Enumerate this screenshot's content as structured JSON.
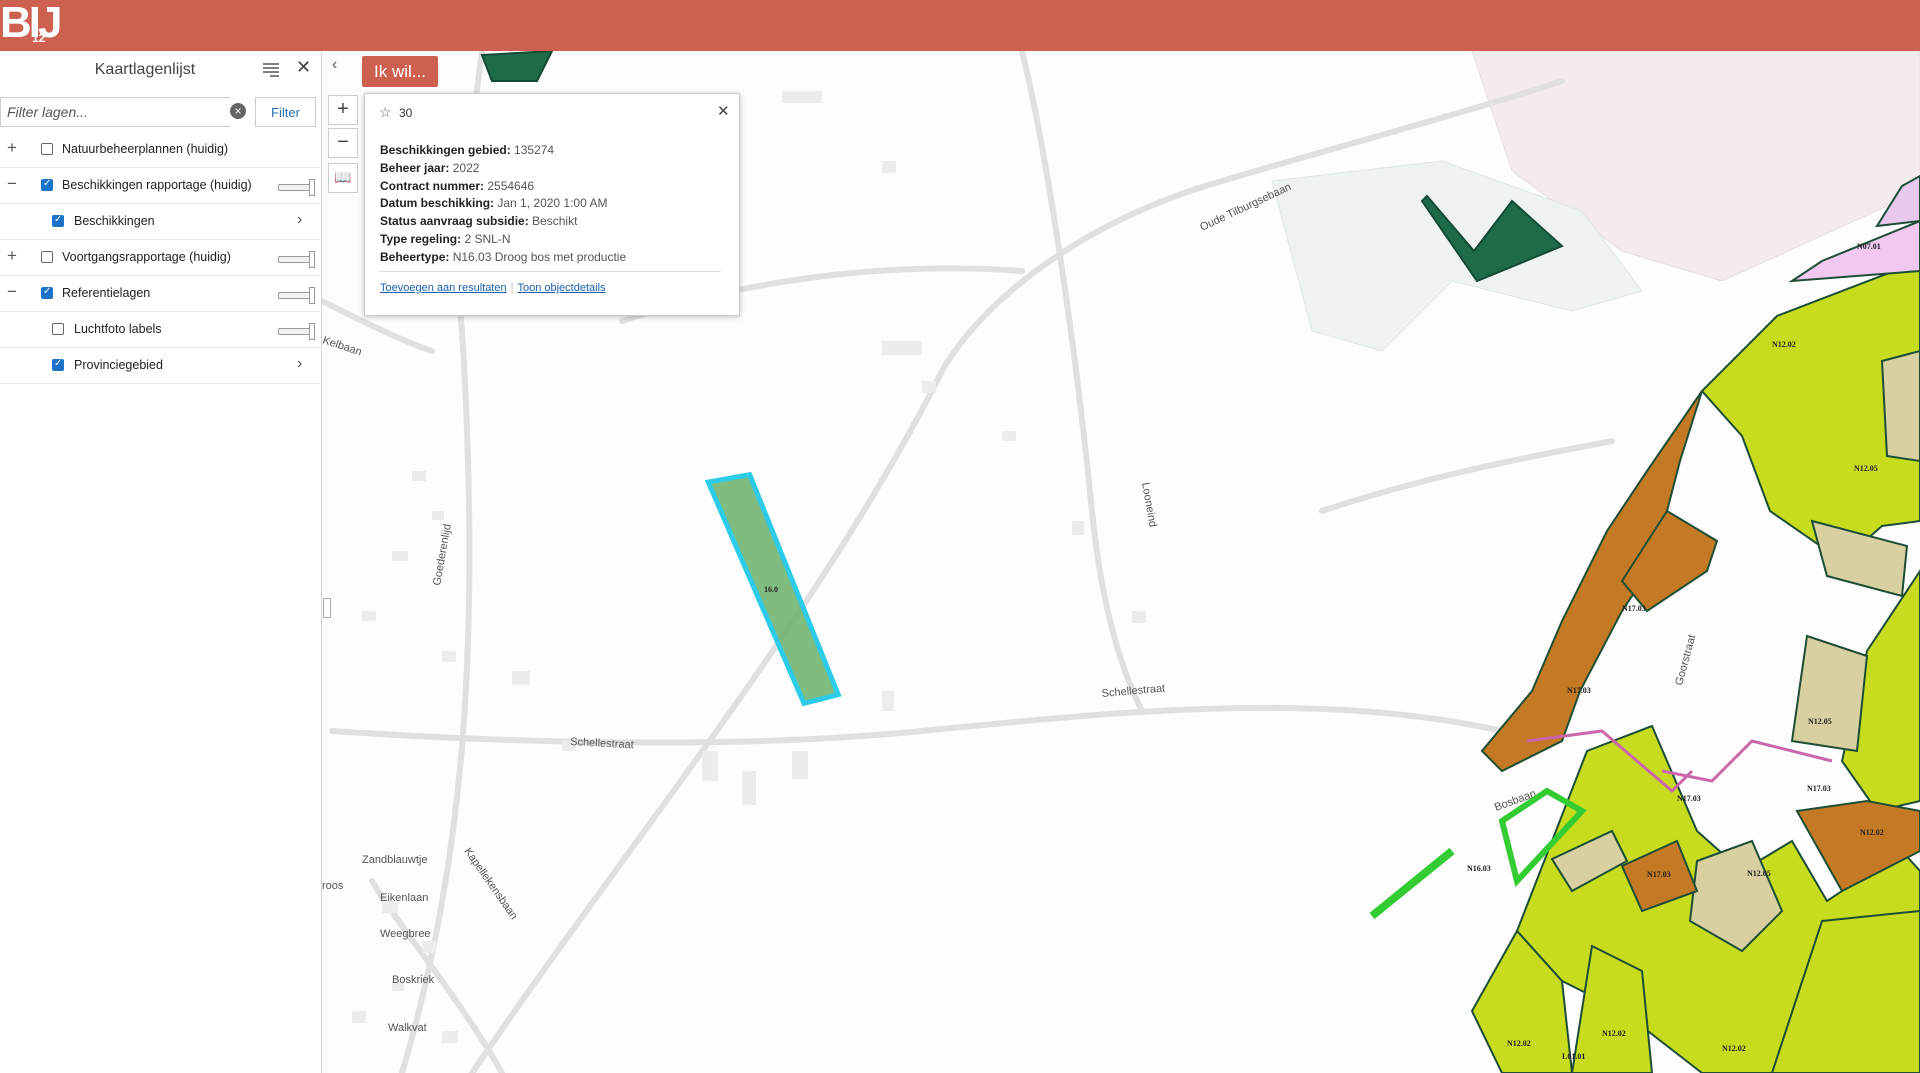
{
  "app": {
    "logo_text": "BIJ",
    "logo_sub": "12",
    "brand_color": "#cd604e"
  },
  "panel": {
    "title": "Kaartlagenlijst",
    "filter_placeholder": "Filter lagen...",
    "filter_button": "Filter",
    "layers": [
      {
        "label": "Natuurbeheerplannen (huidig)",
        "checked": false,
        "expander": "+"
      },
      {
        "label": "Beschikkingen rapportage (huidig)",
        "checked": true,
        "expander": "−"
      },
      {
        "label": "Beschikkingen",
        "checked": true,
        "child": true
      },
      {
        "label": "Voortgangsrapportage (huidig)",
        "checked": false,
        "expander": "+"
      },
      {
        "label": "Referentielagen",
        "checked": true,
        "expander": "−"
      },
      {
        "label": "Luchtfoto labels",
        "checked": false,
        "child": true
      },
      {
        "label": "Provinciegebied",
        "checked": true,
        "child": true
      }
    ]
  },
  "map": {
    "ik_wil_button": "Ik wil...",
    "zoom_in": "+",
    "zoom_out": "−",
    "road_labels": [
      "Kelbaan",
      "Goederenlijd",
      "Oude Tilburgsebaan",
      "Looneind",
      "Schellestraat",
      "Schellestraat",
      "Zandblauwtje",
      "Eikenlaan",
      "Weegbree",
      "Boskriek",
      "Walkvat",
      "Kapellekensbaan",
      "Goorstraat",
      "Bosbaan",
      "roos"
    ],
    "parcel_labels": [
      "N12.02",
      "N12.02",
      "N12.02",
      "N12.05",
      "N12.05",
      "N12.05",
      "N17.03",
      "N17.03",
      "N17.03",
      "N17.03",
      "N17.03",
      "N16.03",
      "N07.01",
      "L01.01",
      "N12.02",
      "N12.02"
    ],
    "selected_label": "16.0"
  },
  "popup": {
    "count": "30",
    "fields": [
      {
        "key": "Beschikkingen gebied:",
        "value": "135274"
      },
      {
        "key": "Beheer jaar:",
        "value": "2022"
      },
      {
        "key": "Contract nummer:",
        "value": "2554646"
      },
      {
        "key": "Datum beschikking:",
        "value": "Jan 1, 2020 1:00 AM"
      },
      {
        "key": "Status aanvraag subsidie:",
        "value": "Beschikt"
      },
      {
        "key": "Type regeling:",
        "value": "2 SNL-N"
      },
      {
        "key": "Beheertype:",
        "value": "N16.03 Droog bos met productie"
      }
    ],
    "link_add": "Toevoegen aan resultaten",
    "link_details": "Toon objectdetails"
  }
}
